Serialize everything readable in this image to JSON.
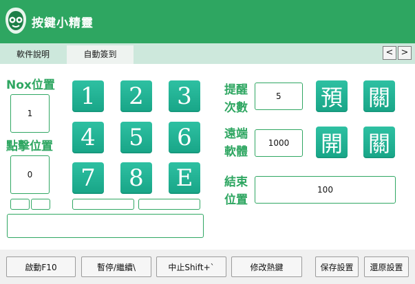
{
  "app": {
    "title": "按鍵小精靈"
  },
  "tabs": [
    {
      "label": "軟件說明"
    },
    {
      "label": "自動簽到"
    }
  ],
  "tab_scroll": {
    "left": "<",
    "right": ">"
  },
  "labels": {
    "nox_position": "Nox位置",
    "click_position": "點擊位置",
    "remind_1": "提醒",
    "remind_2": "次數",
    "remote_1": "遠端",
    "remote_2": "軟體",
    "end_1": "結束",
    "end_2": "位置"
  },
  "fields": {
    "nox_position": "1",
    "click_position": "0",
    "remind_count": "5",
    "remote_software": "1000",
    "end_position": "100"
  },
  "keypad": [
    "1",
    "2",
    "3",
    "4",
    "5",
    "6",
    "7",
    "8",
    "E"
  ],
  "toggles": {
    "remind_on": "預",
    "remind_off": "關",
    "remote_on": "開",
    "remote_off": "關"
  },
  "buttons": {
    "start": "啟動F10",
    "pause": "暫停/繼續\\",
    "stop": "中止Shift+`",
    "hotkey": "修改熱鍵",
    "save": "保存設置",
    "restore": "還原設置"
  },
  "colors": {
    "brand": "#2ea661",
    "key": "#1fb394"
  }
}
